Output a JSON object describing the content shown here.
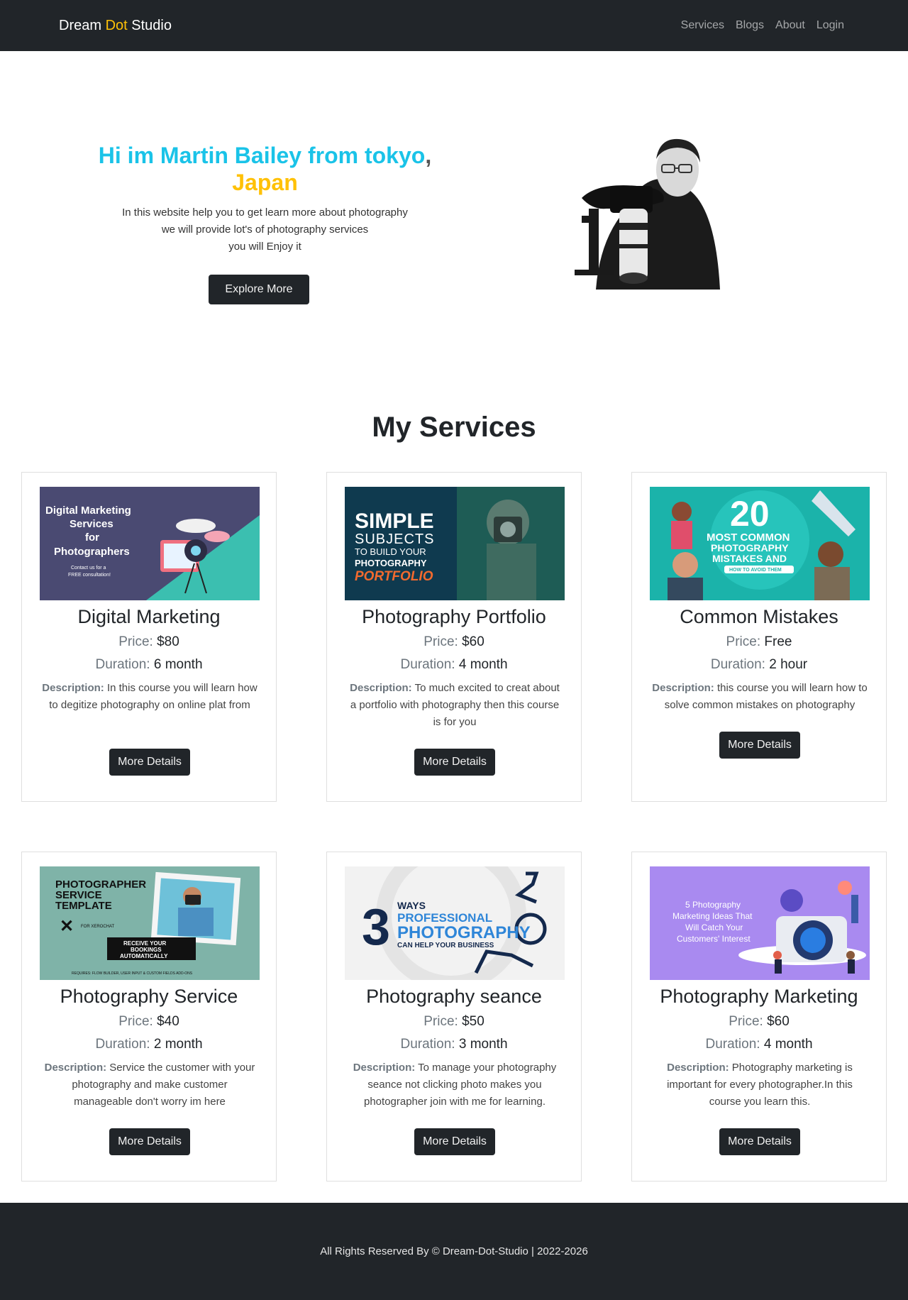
{
  "nav": {
    "brand_part1": "Dream ",
    "brand_accent": "Dot",
    "brand_part2": " Studio",
    "links": [
      "Services",
      "Blogs",
      "About",
      "Login"
    ]
  },
  "hero": {
    "title_main": "Hi im Martin Bailey from tokyo",
    "title_comma": ",",
    "title_accent": "Japan",
    "desc_lines": [
      "In this website help you to get learn more about photography",
      "we will provide lot's of photography services",
      "you will Enjoy it"
    ],
    "button": "Explore More"
  },
  "services": {
    "title": "My Services",
    "price_label": "Price:",
    "duration_label": "Duration:",
    "desc_label": "Description:",
    "button": "More Details",
    "items": [
      {
        "title": "Digital Marketing",
        "price": "$80",
        "duration": "6 month",
        "desc": "In this course you will learn how to degitize photography on online plat from",
        "image_text": [
          "Digital Marketing",
          "Services",
          "for",
          "Photographers",
          "Contact us for a",
          "FREE consultation!"
        ]
      },
      {
        "title": "Photography Portfolio",
        "price": "$60",
        "duration": "4 month",
        "desc": "To much excited to creat about a portfolio with photography then this course is for you",
        "image_text": [
          "SIMPLE",
          "SUBJECTS",
          "TO BUILD YOUR",
          "PHOTOGRAPHY",
          "PORTFOLIO"
        ]
      },
      {
        "title": "Common Mistakes",
        "price": "Free",
        "duration": "2 hour",
        "desc": "this course you will learn how to solve common mistakes on photography",
        "image_text": [
          "20",
          "MOST COMMON",
          "PHOTOGRAPHY",
          "MISTAKES AND",
          "HOW TO AVOID THEM"
        ]
      },
      {
        "title": "Photography Service",
        "price": "$40",
        "duration": "2 month",
        "desc": "Service the customer with your photography and make customer manageable don't worry im here",
        "image_text": [
          "PHOTOGRAPHER",
          "SERVICE",
          "TEMPLATE",
          "FOR XEROCHAT",
          "RECEIVE YOUR",
          "BOOKINGS",
          "AUTOMATICALLY",
          "REQUIRES: FLOW BUILDER, USER INPUT & CUSTOM FIELDS ADD-ONS"
        ]
      },
      {
        "title": "Photography seance",
        "price": "$50",
        "duration": "3 month",
        "desc": "To manage your photography seance not clicking photo makes you photographer join with me for learning.",
        "image_text": [
          "3",
          "WAYS",
          "PROFESSIONAL",
          "PHOTOGRAPHY",
          "CAN HELP YOUR BUSINESS"
        ]
      },
      {
        "title": "Photography Marketing",
        "price": "$60",
        "duration": "4 month",
        "desc": "Photography marketing is important for every photographer.In this course you learn this.",
        "image_text": [
          "5 Photography",
          "Marketing Ideas That",
          "Will Catch Your",
          "Customers' Interest"
        ]
      }
    ]
  },
  "footer": {
    "text": "All Rights Reserved By © Dream-Dot-Studio | 2022-2026"
  },
  "colors": {
    "dark": "#212529",
    "accent_yellow": "#ffc107",
    "accent_cyan": "#1ac3e8"
  }
}
